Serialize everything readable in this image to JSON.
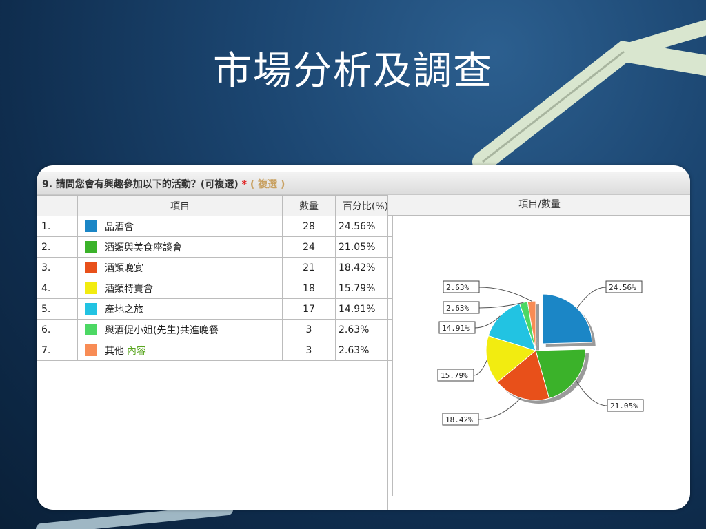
{
  "slide": {
    "title": "市場分析及調查"
  },
  "question": {
    "text": "9. 請問您會有興趣參加以下的活動？(可複選)",
    "required_mark": "*",
    "type_tag": "( 複選 )"
  },
  "table": {
    "headers": {
      "item": "項目",
      "count": "數量",
      "percent": "百分比(%)",
      "chart": "項目/數量"
    }
  },
  "chart_data": {
    "type": "pie",
    "slices": [
      {
        "num": "1.",
        "label": "品酒會",
        "extra": "",
        "value": 28,
        "percent_text": "24.56%",
        "color": "#1b86c6"
      },
      {
        "num": "2.",
        "label": "酒類與美食座談會",
        "extra": "",
        "value": 24,
        "percent_text": "21.05%",
        "color": "#3bb22a"
      },
      {
        "num": "3.",
        "label": "酒類晚宴",
        "extra": "",
        "value": 21,
        "percent_text": "18.42%",
        "color": "#e8501a"
      },
      {
        "num": "4.",
        "label": "酒類特賣會",
        "extra": "",
        "value": 18,
        "percent_text": "15.79%",
        "color": "#f2ec10"
      },
      {
        "num": "5.",
        "label": "產地之旅",
        "extra": "",
        "value": 17,
        "percent_text": "14.91%",
        "color": "#22c3e2"
      },
      {
        "num": "6.",
        "label": "與酒促小姐(先生)共進晚餐",
        "extra": "",
        "value": 3,
        "percent_text": "2.63%",
        "color": "#4cd864"
      },
      {
        "num": "7.",
        "label": "其他",
        "extra": "內容",
        "value": 3,
        "percent_text": "2.63%",
        "color": "#f88c55"
      }
    ],
    "exploded_slice": 0
  }
}
